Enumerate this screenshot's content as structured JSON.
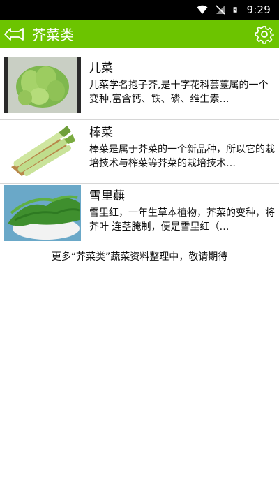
{
  "status": {
    "time": "9:29"
  },
  "header": {
    "title": "芥菜类",
    "back_icon": "back-arrow-icon",
    "settings_icon": "gear-icon"
  },
  "items": [
    {
      "name": "儿菜",
      "desc": "儿菜学名抱子芥,是十字花科芸薹属的一个变种,富含钙、铁、磷、维生素…"
    },
    {
      "name": "棒菜",
      "desc": "棒菜是属于芥菜的一个新品种，所以它的栽培技术与榨菜等芥菜的栽培技术…"
    },
    {
      "name": "雪里蕻",
      "desc": "雪里红，一年生草本植物，芥菜的变种，将芥叶 连茎腌制，便是雪里红（…"
    }
  ],
  "footer": {
    "note": "更多“芥菜类”蔬菜资料整理中，敬请期待"
  },
  "colors": {
    "accent": "#6cc400",
    "divider": "#d6d6d6"
  }
}
